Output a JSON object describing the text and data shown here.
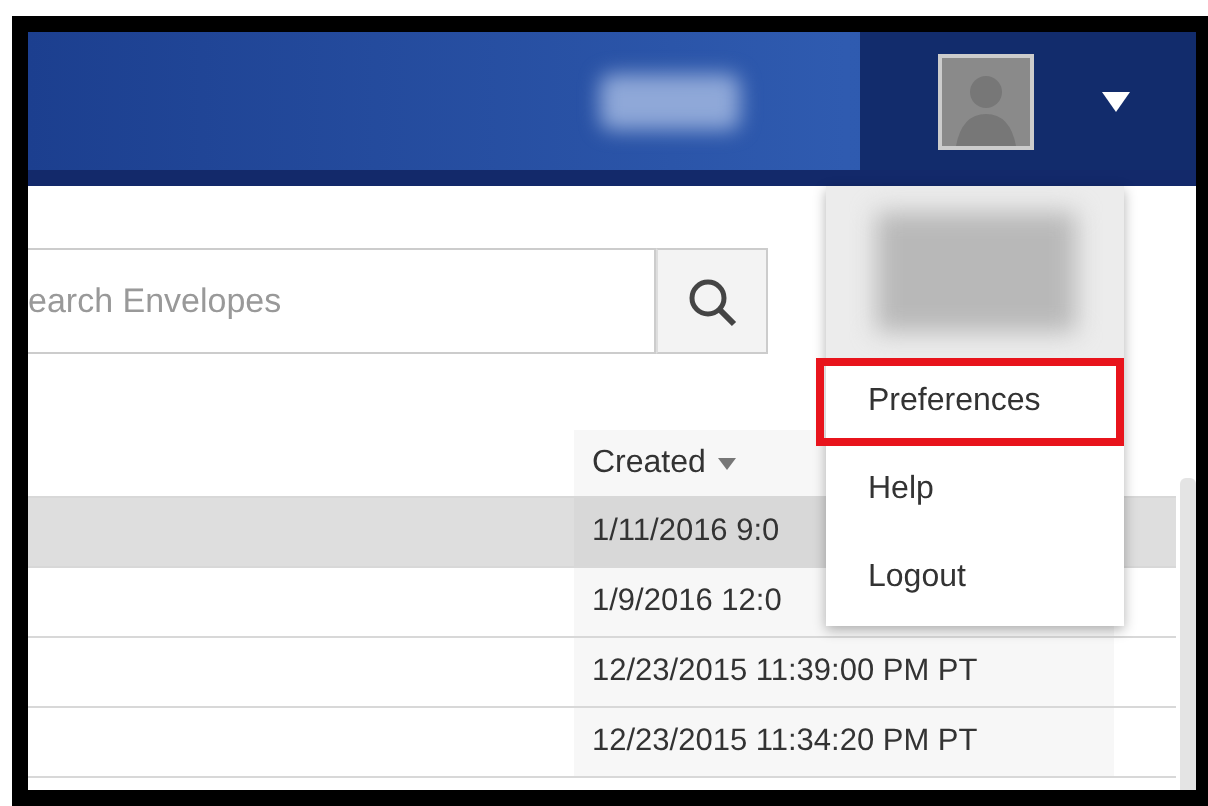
{
  "search": {
    "placeholder": "earch Envelopes"
  },
  "table": {
    "columns": [
      {
        "label": "Created"
      }
    ],
    "rows": [
      {
        "created": "1/11/2016 9:0",
        "selected": true
      },
      {
        "created": "1/9/2016 12:0",
        "selected": false
      },
      {
        "created": "12/23/2015 11:39:00 PM PT",
        "selected": false
      },
      {
        "created": "12/23/2015 11:34:20 PM PT",
        "selected": false
      }
    ]
  },
  "user_menu": {
    "items": [
      {
        "label": "Preferences",
        "selected": true
      },
      {
        "label": "Help",
        "selected": false
      },
      {
        "label": "Logout",
        "selected": false
      }
    ]
  }
}
